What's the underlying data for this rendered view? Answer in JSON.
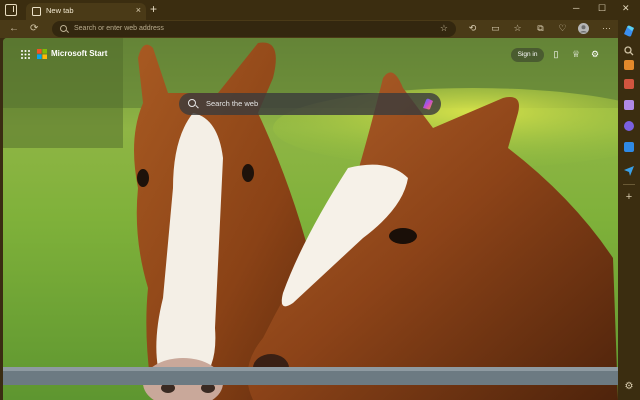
{
  "tab": {
    "title": "New tab",
    "close": "×"
  },
  "new_tab_glyph": "+",
  "window": {
    "minimize": "─",
    "maximize": "☐",
    "close": "✕"
  },
  "toolbar": {
    "back": "←",
    "refresh": "⟳",
    "address_placeholder": "Search or enter web address",
    "star": "☆",
    "more": "···"
  },
  "page": {
    "brand": "Microsoft Start",
    "sign_in": "Sign in",
    "search_placeholder": "Search the web"
  },
  "sidebar": {
    "add": "+",
    "settings": "⚙",
    "items": [
      {
        "icon": "search-icon",
        "color": "#cfc2a4"
      },
      {
        "icon": "briefcase-icon",
        "color": "#e3892b"
      },
      {
        "icon": "shopping-icon",
        "color": "#d2553f"
      },
      {
        "icon": "games-icon",
        "color": "#b089e6"
      },
      {
        "icon": "m365-icon",
        "color": "#7a60e0"
      },
      {
        "icon": "outlook-icon",
        "color": "#2f8ae6"
      },
      {
        "icon": "send-icon",
        "color": "#3aa0e8"
      }
    ]
  },
  "colors": {
    "chrome": "#3b2d10",
    "toolbar": "#4a3a17",
    "copilot_gradient": [
      "#2e7df5",
      "#c64bd6",
      "#f59a2e"
    ]
  }
}
